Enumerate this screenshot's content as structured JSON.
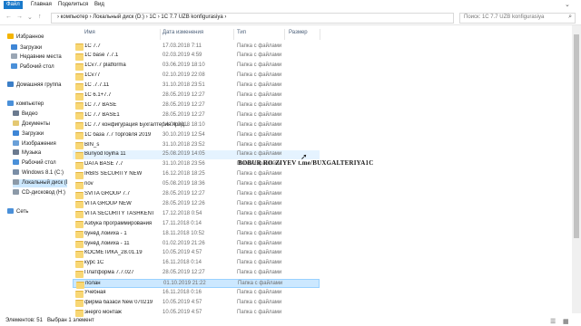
{
  "ribbon": {
    "tabs": [
      "Файл",
      "Главная",
      "Поделиться",
      "Вид"
    ]
  },
  "address": {
    "crumbs": "› компьютер › Локальный диск (D:) › 1C › 1C 7.7 UZB konfigurasiya ›",
    "search_placeholder": "Поиск: 1C 7.7 UZB konfigurasiya"
  },
  "columns": {
    "name": "Имя",
    "date": "Дата изменения",
    "type": "Тип",
    "size": "Размер"
  },
  "nav": [
    {
      "label": "Избранное",
      "color": "#f4b400"
    },
    {
      "label": "Загрузки",
      "color": "#3e86d6"
    },
    {
      "label": "Недавние места",
      "color": "#9aa6b4"
    },
    {
      "label": "Рабочий стол",
      "color": "#4a90d9"
    },
    {
      "label": "Домашняя группа",
      "color": "#3c7fc7"
    },
    {
      "label": "компьютер",
      "color": "#4a90d9"
    },
    {
      "label": "Видео",
      "color": "#6b7a8f"
    },
    {
      "label": "Документы",
      "color": "#e4c872"
    },
    {
      "label": "Загрузки",
      "color": "#3e86d6"
    },
    {
      "label": "Изображения",
      "color": "#6aa0d8"
    },
    {
      "label": "Музыка",
      "color": "#6b7a8f"
    },
    {
      "label": "Рабочий стол",
      "color": "#4a90d9"
    },
    {
      "label": "Windows 8.1 (C:)",
      "color": "#7a8ea6"
    },
    {
      "label": "Локальный диск (D",
      "color": "#8c9aa8"
    },
    {
      "label": "CD-дисковод (H:)",
      "color": "#8c9aa8"
    },
    {
      "label": "Сеть",
      "color": "#4a90d9"
    }
  ],
  "files": [
    {
      "name": "1С 7.7",
      "date": "17.03.2018 7:11",
      "type": "Папка с файлами"
    },
    {
      "name": "1С base 7.7.1",
      "date": "02.03.2019 4:59",
      "type": "Папка с файлами"
    },
    {
      "name": "1Cv7.7 platforma",
      "date": "03.06.2019 18:10",
      "type": "Папка с файлами"
    },
    {
      "name": "1Cv77",
      "date": "02.10.2019 22:08",
      "type": "Папка с файлами"
    },
    {
      "name": "1С .7.7.11",
      "date": "31.10.2018 23:51",
      "type": "Папка с файлами"
    },
    {
      "name": "1С 6.1+7.7",
      "date": "28.05.2019 12:27",
      "type": "Папка с файлами"
    },
    {
      "name": "1С 7.7 BASE",
      "date": "28.05.2019 12:27",
      "type": "Папка с файлами"
    },
    {
      "name": "1С 7.7 BASE1",
      "date": "28.05.2019 12:27",
      "type": "Папка с файлами"
    },
    {
      "name": "1С 7.7 конфигурация Бухгалтерия пред...",
      "date": "14.04.2018 18:10",
      "type": "Папка с файлами"
    },
    {
      "name": "1С база 7.7 торговля 2019",
      "date": "30.10.2019 12:54",
      "type": "Папка с файлами"
    },
    {
      "name": "BIN_s",
      "date": "31.10.2018 23:52",
      "type": "Папка с файлами"
    },
    {
      "name": "Bunyod loyiha 11",
      "date": "25.08.2019 14:05",
      "type": "Папка с файлами"
    },
    {
      "name": "DATA BASE 7.7",
      "date": "31.10.2018 23:56",
      "type": "Папка с файлами"
    },
    {
      "name": "IRBIS SECURITY NEW",
      "date": "16.12.2018 18:25",
      "type": "Папка с файлами"
    },
    {
      "name": "nov",
      "date": "05.08.2019 18:36",
      "type": "Папка с файлами"
    },
    {
      "name": "SVITA GROUP 7.7",
      "date": "28.05.2019 12:27",
      "type": "Папка с файлами"
    },
    {
      "name": "VITA GROUP NEW",
      "date": "28.05.2019 12:26",
      "type": "Папка с файлами"
    },
    {
      "name": "VITA SECURITY TASHKENT",
      "date": "17.12.2018 0:54",
      "type": "Папка с файлами"
    },
    {
      "name": "Азбука программирования",
      "date": "17.11.2018 0:14",
      "type": "Папка с файлами"
    },
    {
      "name": "бунёд лойиха - 1",
      "date": "18.11.2018 10:52",
      "type": "Папка с файлами"
    },
    {
      "name": "бунёд лойиха - 11",
      "date": "01.02.2019 21:26",
      "type": "Папка с файлами"
    },
    {
      "name": "КОСМЕТИКА_28.01.19",
      "date": "10.05.2019 4:57",
      "type": "Папка с файлами"
    },
    {
      "name": "курс 1С",
      "date": "16.11.2018 0:14",
      "type": "Папка с файлами"
    },
    {
      "name": "Платформа 7.7.027",
      "date": "28.05.2019 12:27",
      "type": "Папка с файлами"
    },
    {
      "name": "полан",
      "date": "01.10.2019 21:22",
      "type": "Папка с файлами"
    },
    {
      "name": "Учебная",
      "date": "16.11.2018 0:16",
      "type": "Папка с файлами"
    },
    {
      "name": "фирма базаси New 070219",
      "date": "10.05.2019 4:57",
      "type": "Папка с файлами"
    },
    {
      "name": "энерго монтаж",
      "date": "10.05.2019 4:57",
      "type": "Папка с файлами"
    }
  ],
  "status": {
    "count": "Элементов: 51",
    "selected": "Выбран 1 элемент"
  },
  "overlay": {
    "text": "BOBUR RO`ZIYEV  t.me/BUXGALTERIYA1C"
  }
}
